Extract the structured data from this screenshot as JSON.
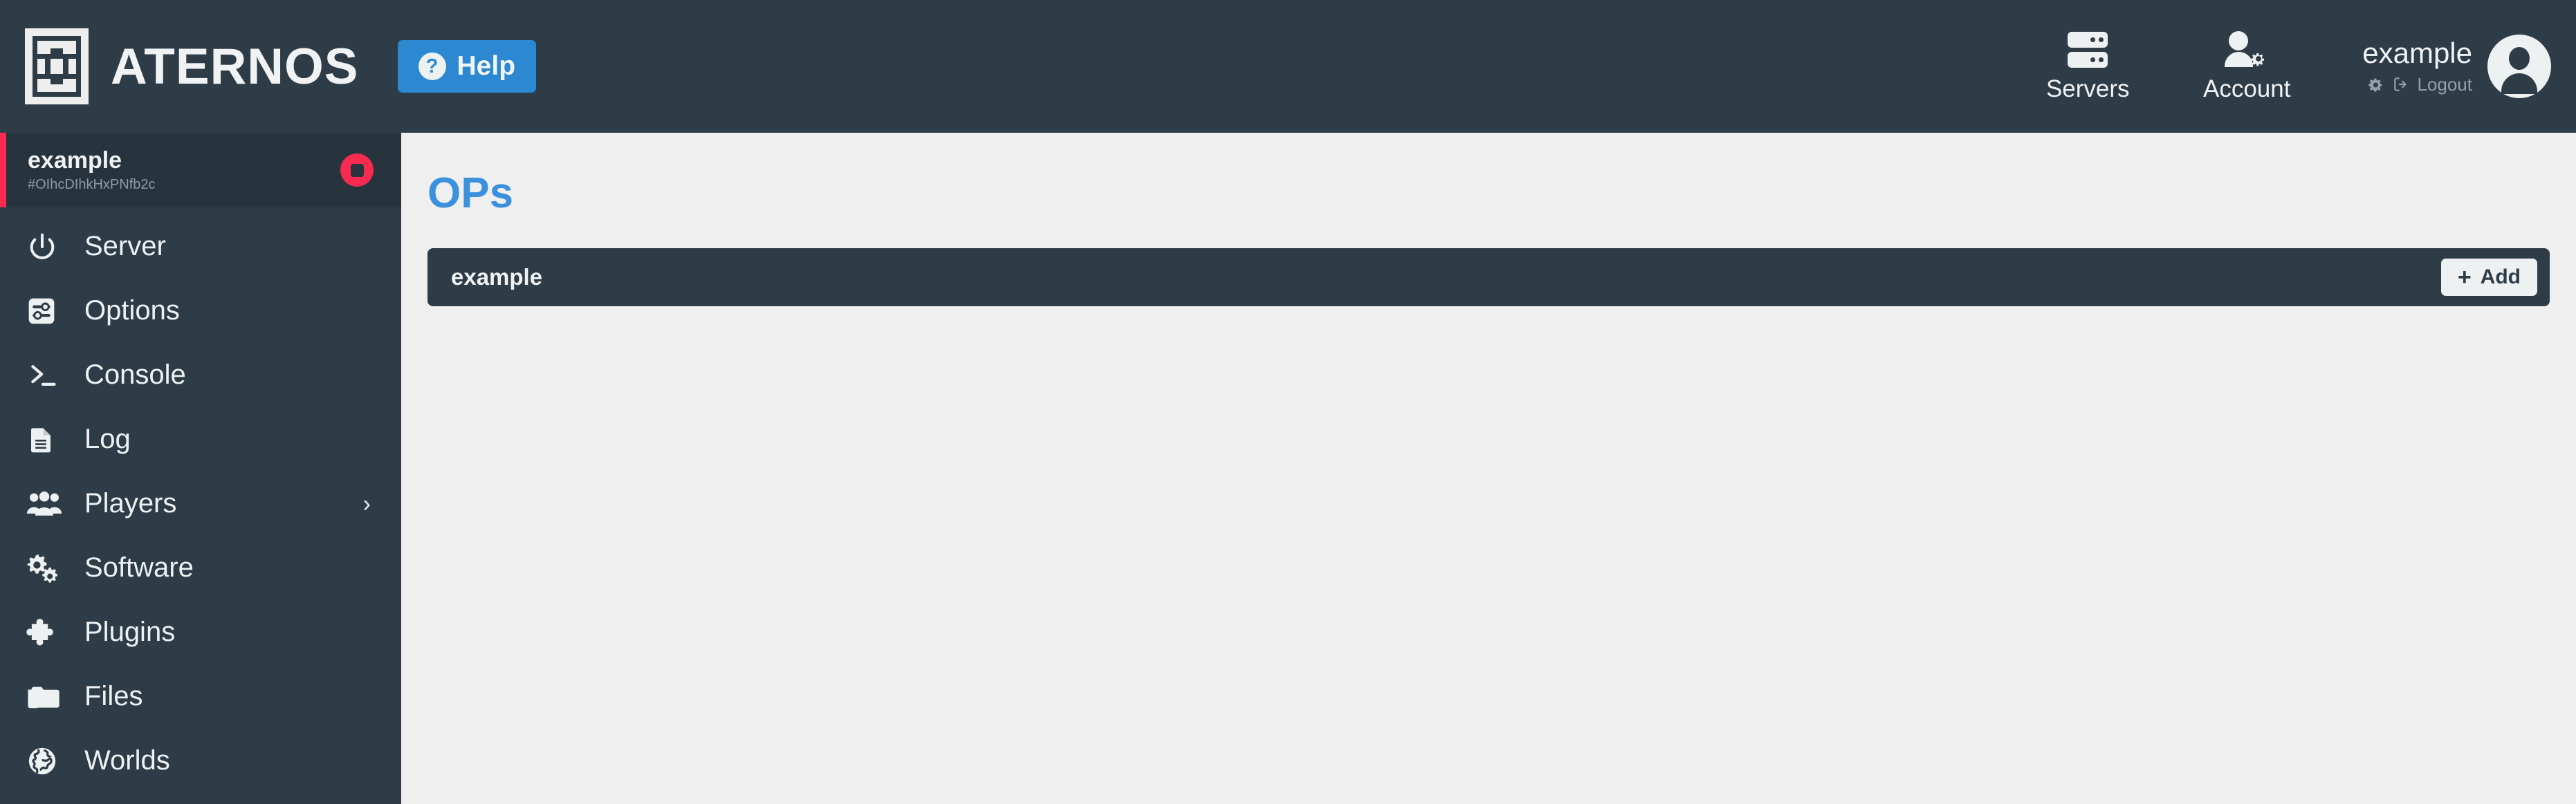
{
  "header": {
    "brand_name": "ATERNOS",
    "logo_icon": "aternos-logo-icon",
    "help": {
      "label": "Help",
      "icon": "question-circle-icon",
      "color": "#2c88d0"
    },
    "nav": [
      {
        "label": "Servers",
        "icon": "server-rack-icon"
      },
      {
        "label": "Account",
        "icon": "user-gear-icon"
      }
    ],
    "user": {
      "name": "example",
      "settings_icon": "gear-icon",
      "logout_icon": "logout-arrow-icon",
      "logout_label": "Logout",
      "avatar_icon": "user-avatar-icon"
    }
  },
  "sidebar": {
    "server": {
      "name": "example",
      "id": "#OIhcDIhkHxPNfb2c",
      "accent_color": "#f72a50",
      "stop_button_icon": "stop-square-icon"
    },
    "items": [
      {
        "label": "Server",
        "icon": "power-icon",
        "chevron": ""
      },
      {
        "label": "Options",
        "icon": "sliders-icon",
        "chevron": ""
      },
      {
        "label": "Console",
        "icon": "terminal-icon",
        "chevron": ""
      },
      {
        "label": "Log",
        "icon": "document-icon",
        "chevron": ""
      },
      {
        "label": "Players",
        "icon": "people-icon",
        "chevron": "›"
      },
      {
        "label": "Software",
        "icon": "gears-icon",
        "chevron": ""
      },
      {
        "label": "Plugins",
        "icon": "puzzle-icon",
        "chevron": ""
      },
      {
        "label": "Files",
        "icon": "folder-icon",
        "chevron": ""
      },
      {
        "label": "Worlds",
        "icon": "globe-icon",
        "chevron": ""
      }
    ]
  },
  "main": {
    "title": "OPs",
    "title_color": "#3c91dd",
    "ops": [
      {
        "name": "example"
      }
    ],
    "add_button": {
      "label": "Add",
      "plus": "+",
      "icon": "plus-icon"
    }
  }
}
